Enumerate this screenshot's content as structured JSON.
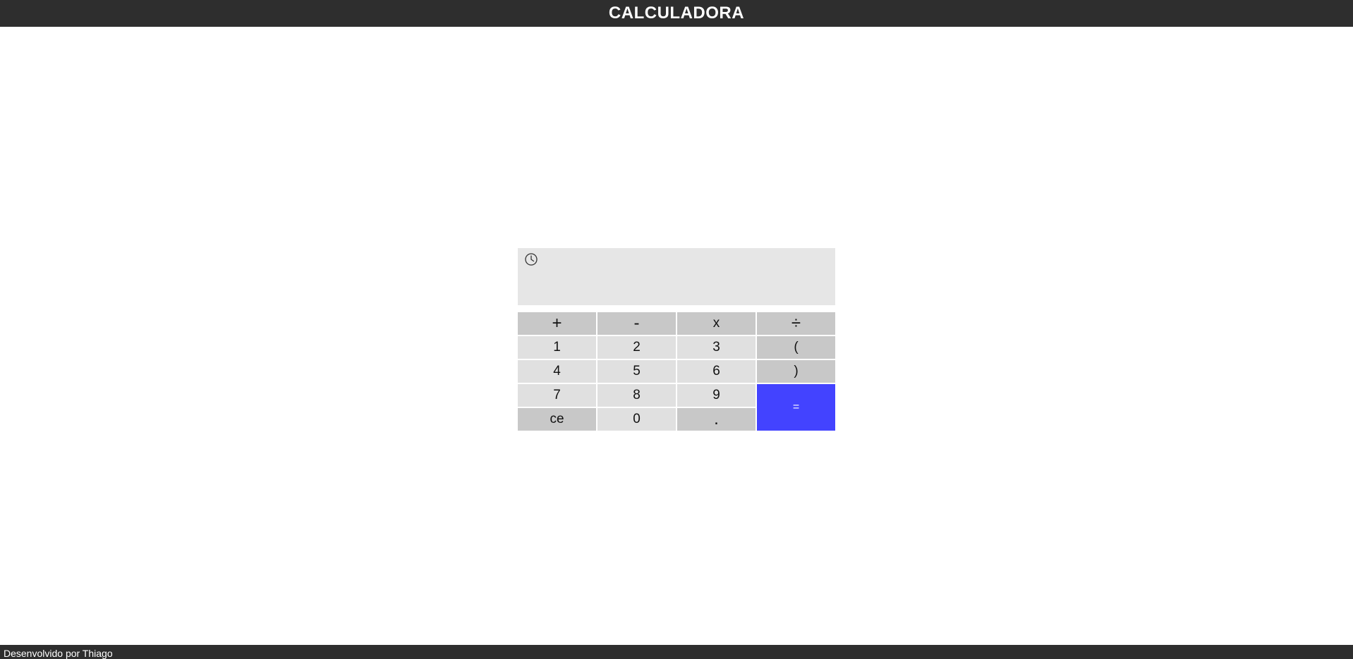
{
  "header": {
    "title": "CALCULADORA"
  },
  "display": {
    "history_icon": "clock-icon",
    "value": ""
  },
  "keypad": {
    "plus": "+",
    "minus": "-",
    "multiply": "x",
    "divide": "÷",
    "one": "1",
    "two": "2",
    "three": "3",
    "open_paren": "(",
    "four": "4",
    "five": "5",
    "six": "6",
    "close_paren": ")",
    "seven": "7",
    "eight": "8",
    "nine": "9",
    "equals": "=",
    "clear": "ce",
    "zero": "0",
    "decimal": "."
  },
  "colors": {
    "header_bg": "#2e2e2e",
    "display_bg": "#e6e6e6",
    "key_dark": "#c8c8c8",
    "key_light": "#e0e0e0",
    "equals_bg": "#4343ff"
  },
  "footer": {
    "credit": "Desenvolvido por Thiago"
  }
}
